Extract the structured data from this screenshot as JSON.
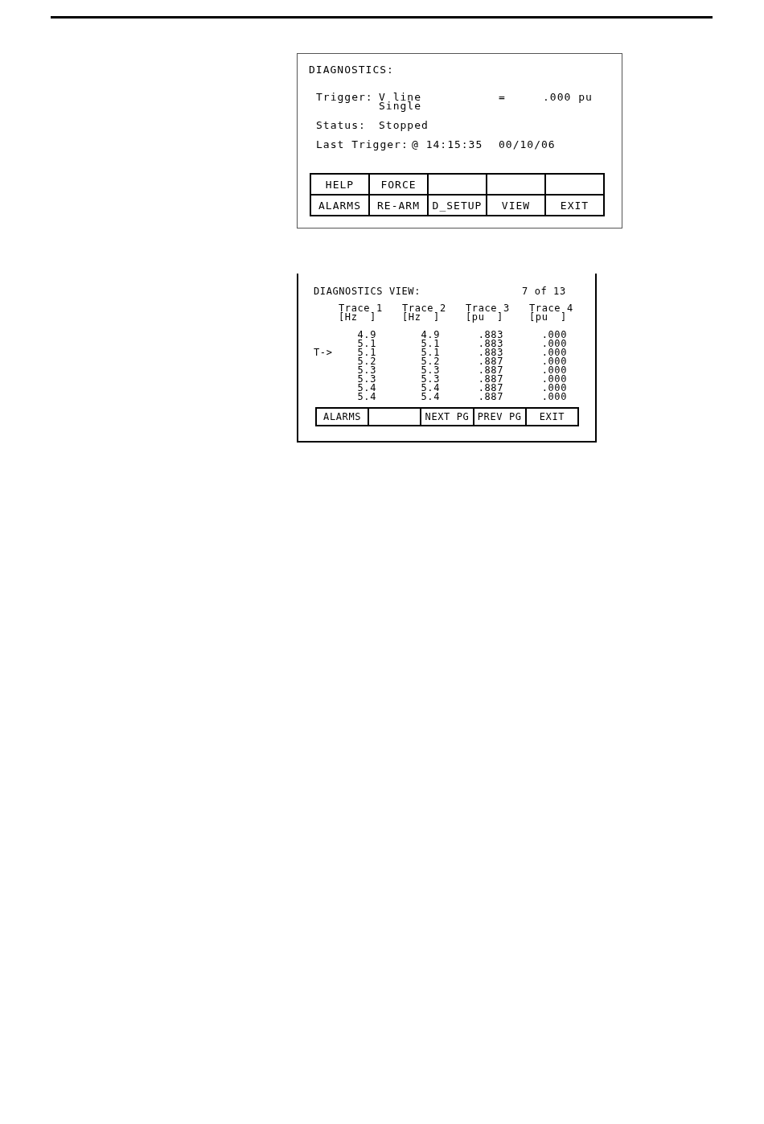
{
  "diagnostics": {
    "title": "DIAGNOSTICS:",
    "trigger": {
      "label": "Trigger:",
      "signal": "V line",
      "mode": "Single",
      "operator": "=",
      "value": ".000 pu"
    },
    "status": {
      "label": "Status:",
      "value": "Stopped"
    },
    "last_trigger": {
      "label": "Last Trigger:",
      "time": "@ 14:15:35",
      "date": "00/10/06"
    },
    "softkeys": [
      [
        {
          "kind": "key",
          "label": "HELP"
        },
        {
          "kind": "key",
          "label": "FORCE"
        },
        {
          "kind": "blank"
        },
        {
          "kind": "blank"
        },
        {
          "kind": "blank"
        }
      ],
      [
        {
          "kind": "key",
          "label": "ALARMS"
        },
        {
          "kind": "key",
          "label": "RE-ARM"
        },
        {
          "kind": "key",
          "label": "D_SETUP"
        },
        {
          "kind": "key",
          "label": "VIEW"
        },
        {
          "kind": "key",
          "label": "EXIT"
        }
      ]
    ]
  },
  "diagnostics_view": {
    "title": "DIAGNOSTICS VIEW:",
    "page": "7 of 13",
    "traces": [
      {
        "name": "Trace 1",
        "unit": "[Hz  ]"
      },
      {
        "name": "Trace 2",
        "unit": "[Hz  ]"
      },
      {
        "name": "Trace 3",
        "unit": "[pu  ]"
      },
      {
        "name": "Trace 4",
        "unit": "[pu  ]"
      }
    ],
    "rows": [
      {
        "values": [
          "4.9",
          "4.9",
          ".883",
          ".000"
        ]
      },
      {
        "values": [
          "5.1",
          "5.1",
          ".883",
          ".000"
        ]
      },
      {
        "marker": "T->",
        "values": [
          "5.1",
          "5.1",
          ".883",
          ".000"
        ]
      },
      {
        "values": [
          "5.2",
          "5.2",
          ".887",
          ".000"
        ]
      },
      {
        "values": [
          "5.3",
          "5.3",
          ".887",
          ".000"
        ]
      },
      {
        "values": [
          "5.3",
          "5.3",
          ".887",
          ".000"
        ]
      },
      {
        "values": [
          "5.4",
          "5.4",
          ".887",
          ".000"
        ]
      },
      {
        "values": [
          "5.4",
          "5.4",
          ".887",
          ".000"
        ]
      }
    ],
    "softkeys": [
      {
        "kind": "key",
        "label": "ALARMS"
      },
      {
        "kind": "blank"
      },
      {
        "kind": "key",
        "label": "NEXT PG"
      },
      {
        "kind": "key",
        "label": "PREV PG"
      },
      {
        "kind": "key",
        "label": "EXIT"
      }
    ]
  }
}
